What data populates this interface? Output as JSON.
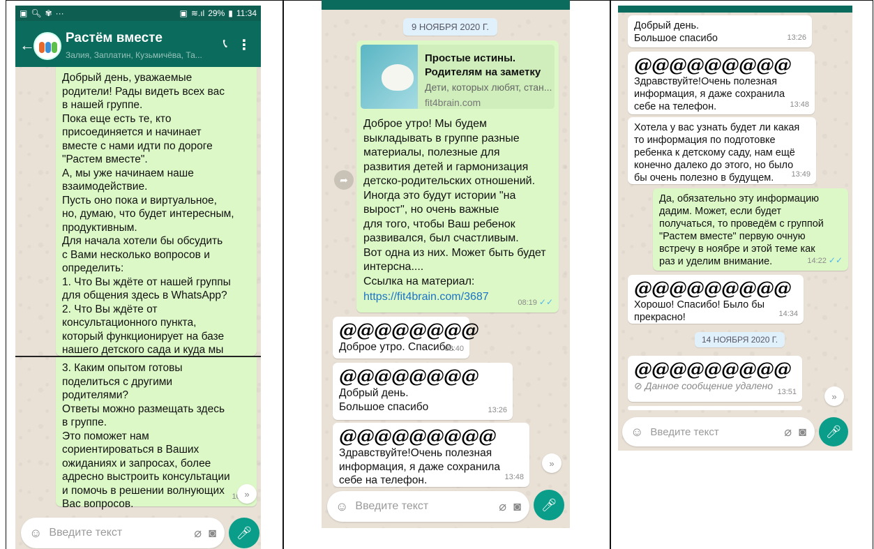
{
  "colors": {
    "header": "#0b6b5d",
    "outgoing": "#dcf8c6",
    "incoming": "#ffffff",
    "accent": "#0a9e8a",
    "link": "#1a73c7",
    "ticks": "#4fb6ec"
  },
  "screen1": {
    "status": {
      "time": "11:34",
      "battery": "29%"
    },
    "header": {
      "title": "Растём вместе",
      "subtitle": "Залия, Заплатин, Кузьмичёва, Та..."
    },
    "msg1": "Добрый день, уважаемые\nродители! Рады видеть всех вас\nв нашей группе.\nПока еще есть те, кто\nприсоединяется и начинает\nвместе с нами идти по дороге\n\"Растем вместе\".\n А, мы уже начинаем наше\nвзаимодействие.\nПусть оно пока и виртуальное,\nно, думаю, что будет интересным,\nпродуктивным.\nДля начала хотели бы обсудить\nс Вами несколько вопросов и\nопределить:\n1. Что Вы  ждёте от нашей группы\nдля общения здесь в WhatsApp?\n2. Что  Вы  ждёте от\nконсультационного пункта,\nкоторый функционирует на базе\nнашего детского сада и куда мы\nВас пригласили?",
    "msg2": "3. Каким опытом готовы\nподелиться с другими\nродителями?\nОтветы можно размещать здесь\nв группе.\n Это поможет нам\nсориентироваться в Ваших\nожиданиях и запросах, более\nадресно выстроить консультации\nи помочь в решении волнующих\nВас вопросов.",
    "msg2_time": "10:31",
    "input_placeholder": "Введите текст"
  },
  "screen2": {
    "date": "9 НОЯБРЯ 2020 Г.",
    "preview": {
      "title": "Простые истины.\nРодителям на заметку",
      "desc": "Дети, которых любят, стан...",
      "domain": "fit4brain.com"
    },
    "msg1": "Доброе утро! Мы будем\nвыкладывать в группе разные\nматериалы, полезные для\nразвития детей и гармонизация\nдетско-родительских отношений.\nИногда это будут истории \"на\nвырост\", но очень важные\nдля того, чтобы Ваш ребенок\nразвивался, был счастливым.\nВот одна из них. Может быть будет\nинтерсна....\nСсылка на материал:",
    "msg1_link": "https://fit4brain.com/3687",
    "msg1_time": "08:19",
    "sender_mask": "@@@@@@@@",
    "sender_mask_long": "@@@@@@@@@",
    "msg2": "Доброе утро. Спасибо.",
    "msg2_time": "08:40",
    "msg3": "Добрый день.\nБольшое спасибо",
    "msg3_time": "13:26",
    "msg4": "Здравствуйте!Очень полезная\nинформация, я даже сохранила\nсебе на телефон.",
    "msg4_time": "13:48",
    "input_placeholder": "Введите текст"
  },
  "screen3": {
    "msg1": "Добрый день.\nБольшое спасибо",
    "msg1_time": "13:26",
    "sender_mask": "@@@@@@@@@",
    "msg2": "Здравствуйте!Очень полезная\nинформация, я даже сохранила\nсебе на телефон.",
    "msg2_time": "13:48",
    "msg3": "Хотела у вас узнать будет ли какая\nто информация по подготовке\nребенка к детскому саду, нам ещё\nконечно далеко до этого, но было\nбы очень полезно в будущем.",
    "msg3_time": "13:49",
    "msg4": "Да, обязательно эту информацию\nдадим. Может, если будет\nполучаться, то проведём с группой\n\"Растем вместе\" первую очную\nвстречу в ноябре и этой теме как\nраз и уделим внимание.",
    "msg4_time": "14:22",
    "msg5": "Хорошо! Спасибо! Было бы\nпрекрасно!",
    "msg5_time": "14:34",
    "date": "14 НОЯБРЯ 2020 Г.",
    "msg6": "Данное сообщение удалено",
    "msg6_time": "13:51",
    "input_placeholder": "Введите текст"
  }
}
